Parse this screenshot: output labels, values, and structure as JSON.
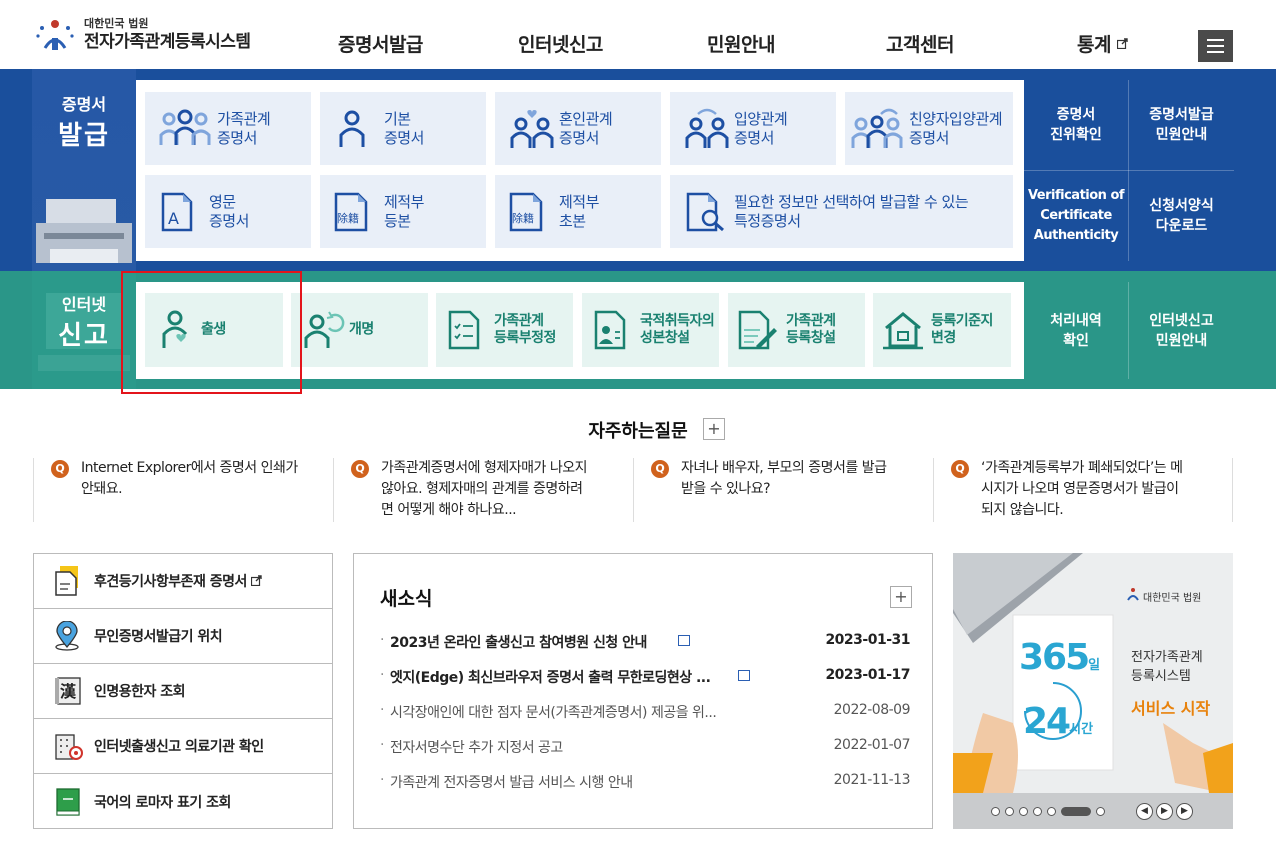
{
  "header": {
    "org": "대한민국 법원",
    "system": "전자가족관계등록시스템",
    "nav": [
      "증명서발급",
      "인터넷신고",
      "민원안내",
      "고객센터",
      "통계"
    ]
  },
  "cert": {
    "title_small": "증명서",
    "title_big": "발급",
    "cards": [
      {
        "l1": "가족관계",
        "l2": "증명서"
      },
      {
        "l1": "기본",
        "l2": "증명서"
      },
      {
        "l1": "혼인관계",
        "l2": "증명서"
      },
      {
        "l1": "입양관계",
        "l2": "증명서"
      },
      {
        "l1": "친양자입양관계",
        "l2": "증명서"
      },
      {
        "l1": "영문",
        "l2": "증명서"
      },
      {
        "l1": "제적부",
        "l2": "등본"
      },
      {
        "l1": "제적부",
        "l2": "초본"
      },
      {
        "l1": "필요한 정보만 선택하여 발급할 수 있는",
        "l2": "특정증명서"
      }
    ],
    "side": [
      {
        "l1": "증명서",
        "l2": "진위확인"
      },
      {
        "l1": "증명서발급",
        "l2": "민원안내"
      },
      {
        "l1": "Verification of",
        "l2": "Certificate",
        "l3": "Authenticity"
      },
      {
        "l1": "신청서양식",
        "l2": "다운로드"
      }
    ]
  },
  "report": {
    "title_small": "인터넷",
    "title_big": "신고",
    "cards": [
      {
        "l1": "출생",
        "l2": ""
      },
      {
        "l1": "개명",
        "l2": ""
      },
      {
        "l1": "가족관계",
        "l2": "등록부정정"
      },
      {
        "l1": "국적취득자의",
        "l2": "성본창설"
      },
      {
        "l1": "가족관계",
        "l2": "등록창설"
      },
      {
        "l1": "등록기준지",
        "l2": "변경"
      }
    ],
    "side": [
      {
        "l1": "처리내역",
        "l2": "확인"
      },
      {
        "l1": "인터넷신고",
        "l2": "민원안내"
      }
    ]
  },
  "faq": {
    "title": "자주하는질문",
    "items": [
      {
        "l1": "Internet Explorer에서 증명서 인쇄가",
        "l2": "안돼요.",
        "l3": ""
      },
      {
        "l1": "가족관계증명서에 형제자매가 나오지",
        "l2": "않아요. 형제자매의 관계를 증명하려",
        "l3": "면 어떻게 해야 하나요..."
      },
      {
        "l1": "자녀나 배우자, 부모의 증명서를 발급",
        "l2": "받을 수 있나요?",
        "l3": ""
      },
      {
        "l1": "‘가족관계등록부가 폐쇄되었다’는 메",
        "l2": "시지가 나오며 영문증명서가 발급이",
        "l3": "되지 않습니다."
      }
    ]
  },
  "quick": [
    "후견등기사항부존재 증명서",
    "무인증명서발급기 위치",
    "인명용한자 조회",
    "인터넷출생신고 의료기관 확인",
    "국어의 로마자 표기 조회"
  ],
  "news": {
    "title": "새소식",
    "items": [
      {
        "title": "2023년 온라인 출생신고 참여병원 신청 안내",
        "date": "2023-01-31"
      },
      {
        "title": "엣지(Edge) 최신브라우저 증명서 출력 무한로딩현상 ...",
        "date": "2023-01-17"
      },
      {
        "title": "시각장애인에 대한 점자 문서(가족관계증명서) 제공을 위...",
        "date": "2022-08-09"
      },
      {
        "title": "전자서명수단 추가 지정서 공고",
        "date": "2022-01-07"
      },
      {
        "title": "가족관계 전자증명서 발급 서비스 시행 안내",
        "date": "2021-11-13"
      }
    ]
  },
  "banner": {
    "org": "대한민국 법원",
    "days": "365",
    "days_unit": "일",
    "hours": "24",
    "hours_unit": "시간",
    "system_l1": "전자가족관계",
    "system_l2": "등록시스템",
    "tagline": "서비스 시작"
  }
}
